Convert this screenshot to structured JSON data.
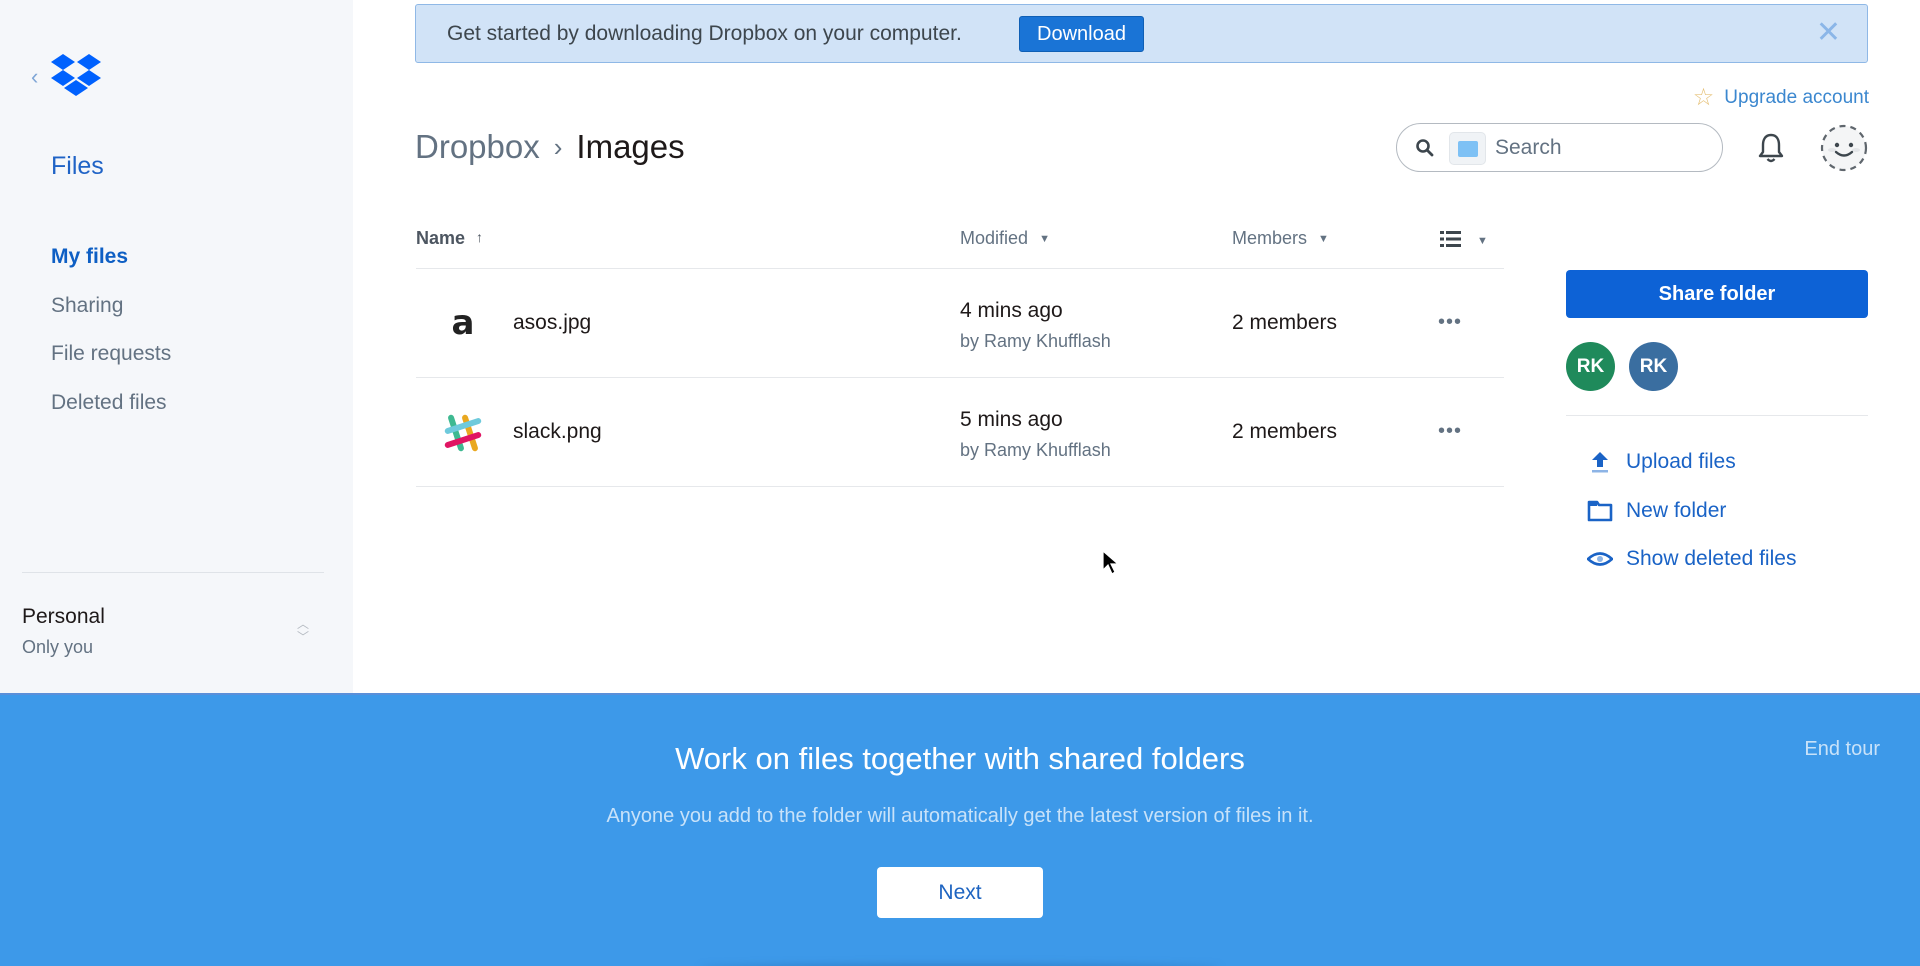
{
  "sidebar": {
    "back_icon": "chevron-left-icon",
    "logo_icon": "dropbox-logo-icon",
    "title": "Files",
    "items": [
      {
        "label": "My files",
        "active": true
      },
      {
        "label": "Sharing",
        "active": false
      },
      {
        "label": "File requests",
        "active": false
      },
      {
        "label": "Deleted files",
        "active": false
      }
    ],
    "account": {
      "name": "Personal",
      "subtitle": "Only you",
      "switch_icon": "chevron-up-down-icon"
    }
  },
  "banner": {
    "text": "Get started by downloading Dropbox on your computer.",
    "button_label": "Download",
    "close_icon": "close-icon"
  },
  "header": {
    "upgrade_label": "Upgrade account",
    "upgrade_icon": "star-icon",
    "search": {
      "placeholder": "Search",
      "value": "",
      "scope_icon": "folder-icon",
      "icon": "search-icon"
    },
    "notifications_icon": "bell-icon",
    "avatar_icon": "smiley-avatar-icon"
  },
  "breadcrumb": {
    "parent": "Dropbox",
    "separator": "›",
    "current": "Images"
  },
  "table": {
    "columns": {
      "name": "Name",
      "name_sort_icon": "arrow-up-icon",
      "modified": "Modified",
      "members": "Members",
      "view_icon": "list-view-icon"
    },
    "rows": [
      {
        "name": "asos.jpg",
        "thumb": "asos-thumbnail",
        "modified": "4 mins ago",
        "modified_by": "by Ramy Khufflash",
        "members": "2 members",
        "more": "•••"
      },
      {
        "name": "slack.png",
        "thumb": "slack-thumbnail",
        "modified": "5 mins ago",
        "modified_by": "by Ramy Khufflash",
        "members": "2 members",
        "more": "•••"
      }
    ]
  },
  "right_panel": {
    "share_label": "Share folder",
    "members": [
      {
        "initials": "RK",
        "color": "#1f8a5b"
      },
      {
        "initials": "RK",
        "color": "#3a6ea0"
      }
    ],
    "actions": [
      {
        "label": "Upload files",
        "icon": "upload-icon"
      },
      {
        "label": "New folder",
        "icon": "folder-icon"
      },
      {
        "label": "Show deleted files",
        "icon": "eye-icon"
      }
    ]
  },
  "tour": {
    "title": "Work on files together with shared folders",
    "description": "Anyone you add to the folder will automatically get the latest version of files in it.",
    "next_label": "Next",
    "end_label": "End tour"
  },
  "colors": {
    "accent": "#0d62d6",
    "tour_bg": "#3d99e9",
    "sidebar_bg": "#f5f7fa",
    "banner_bg": "#d1e3f7"
  }
}
